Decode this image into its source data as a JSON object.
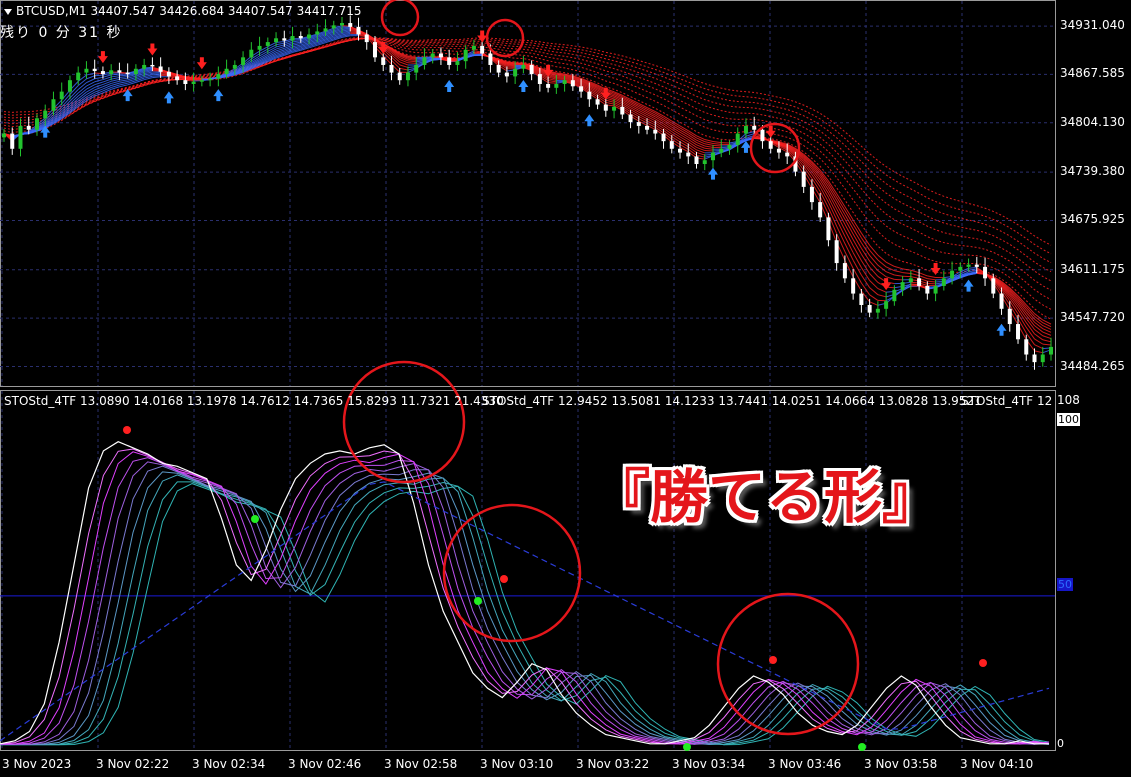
{
  "header": {
    "symbol_line": "BTCUSD,M1  34407.547 34426.684 34407.547 34417.715",
    "remaining": "残り 0 分 31 秒"
  },
  "indicator": {
    "labels": [
      "STOStd_4TF 13.0890 14.0168 13.1978 14.7612 14.7365 15.8293 11.7321 21.4330",
      "STOStd_4TF 12.9452 13.5081 14.1233 13.7441 14.0251 14.0664 13.0828 13.9521",
      "STOStd_4TF 12"
    ],
    "scale_top": "108",
    "scale_100": "100",
    "scale_mid": "50",
    "scale_bottom": "0"
  },
  "callout": "『勝てる形』",
  "colors": {
    "background": "#000000",
    "grid": "#2a2f6e",
    "bull_candle": "#22c32e",
    "bear_candle": "#ffffff",
    "sell_arrow": "#ff2020",
    "buy_arrow": "#2f8fff",
    "ribbon_red": "#ff2222",
    "ribbon_blue": "#3c6cff",
    "stoch_magenta": "#e040ff",
    "stoch_teal": "#2fb4b4",
    "circle": "#e4161b"
  },
  "chart_data": [
    {
      "type": "candlestick",
      "title": "BTCUSD,M1",
      "ylabels": [
        "34931.040",
        "34867.585",
        "34804.130",
        "34739.380",
        "34675.925",
        "34611.175",
        "34547.720",
        "34484.265"
      ],
      "ylim": [
        34460,
        34960
      ],
      "xlabels": [
        "3 Nov 2023",
        "3 Nov 02:22",
        "3 Nov 02:34",
        "3 Nov 02:46",
        "3 Nov 02:58",
        "3 Nov 03:10",
        "3 Nov 03:22",
        "3 Nov 03:34",
        "3 Nov 03:46",
        "3 Nov 03:58",
        "3 Nov 04:10"
      ],
      "close": [
        34790,
        34770,
        34800,
        34795,
        34810,
        34820,
        34835,
        34845,
        34860,
        34870,
        34875,
        34872,
        34868,
        34873,
        34870,
        34868,
        34875,
        34880,
        34878,
        34871,
        34865,
        34860,
        34855,
        34858,
        34860,
        34862,
        34868,
        34875,
        34880,
        34890,
        34900,
        34905,
        34910,
        34915,
        34912,
        34918,
        34915,
        34920,
        34924,
        34928,
        34932,
        34935,
        34930,
        34920,
        34910,
        34890,
        34880,
        34870,
        34860,
        34870,
        34880,
        34890,
        34895,
        34890,
        34880,
        34885,
        34900,
        34905,
        34895,
        34880,
        34870,
        34865,
        34875,
        34880,
        34868,
        34855,
        34850,
        34855,
        34860,
        34852,
        34845,
        34835,
        34828,
        34820,
        34825,
        34815,
        34805,
        34800,
        34795,
        34790,
        34780,
        34770,
        34765,
        34760,
        34750,
        34755,
        34765,
        34770,
        34775,
        34790,
        34800,
        34795,
        34780,
        34770,
        34765,
        34760,
        34740,
        34720,
        34700,
        34680,
        34650,
        34620,
        34600,
        34580,
        34565,
        34555,
        34560,
        34570,
        34585,
        34595,
        34600,
        34590,
        34580,
        34590,
        34600,
        34610,
        34615,
        34618,
        34615,
        34600,
        34580,
        34560,
        34540,
        34520,
        34500,
        34490,
        34500,
        34510
      ]
    },
    {
      "type": "line",
      "title": "STOStd_4TF",
      "ylim": [
        0,
        108
      ],
      "yticks": [
        0,
        50,
        100
      ],
      "series": [
        {
          "values": [
            2,
            3,
            6,
            15,
            35,
            60,
            85,
            97,
            100,
            98,
            96,
            93,
            92,
            90,
            88,
            75,
            60,
            55,
            65,
            78,
            88,
            93,
            96,
            97,
            96,
            98,
            99,
            96,
            80,
            60,
            45,
            35,
            25,
            20,
            17,
            22,
            28,
            26,
            18,
            12,
            8,
            5,
            4,
            3,
            2,
            2,
            3,
            4,
            8,
            14,
            20,
            24,
            22,
            18,
            12,
            8,
            6,
            5,
            8,
            14,
            20,
            24,
            21,
            14,
            8,
            4,
            3,
            2,
            2,
            3,
            2,
            2
          ]
        }
      ]
    }
  ]
}
